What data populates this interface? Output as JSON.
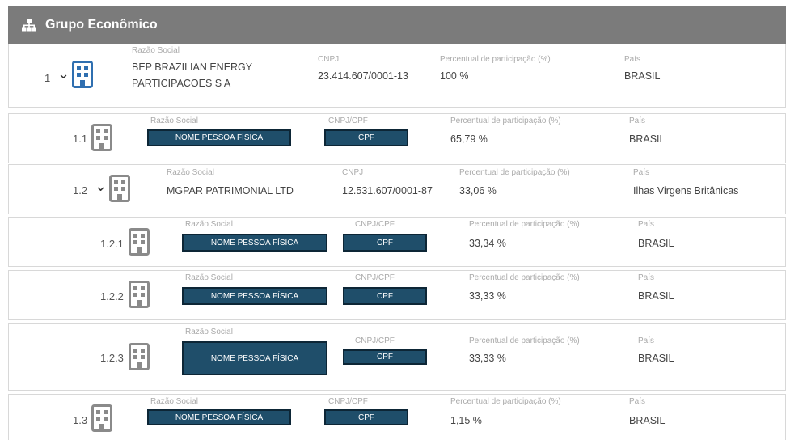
{
  "header": {
    "title": "Grupo Econômico",
    "icon": "org-chart-icon"
  },
  "labels": {
    "razao": "Razão Social",
    "cnpj": "CNPJ",
    "cnpjcpf": "CNPJ/CPF",
    "perc": "Percentual de participação (%)",
    "pais": "País"
  },
  "rows": [
    {
      "index": "1",
      "expandable": true,
      "name": "BEP BRAZILIAN ENERGY PARTICIPACOES S A",
      "doc": "23.414.607/0001-13",
      "percent": "100 %",
      "country": "BRASIL",
      "icon": "building-icon"
    },
    {
      "index": "1.1",
      "expandable": false,
      "name": "NOME PESSOA FÍSICA",
      "doc": "CPF",
      "percent": "65,79 %",
      "country": "BRASIL",
      "icon": "building-icon"
    },
    {
      "index": "1.2",
      "expandable": true,
      "name": "MGPAR PATRIMONIAL LTD",
      "doc": "12.531.607/0001-87",
      "percent": "33,06 %",
      "country": "Ilhas Virgens Britânicas",
      "icon": "building-icon"
    },
    {
      "index": "1.2.1",
      "expandable": false,
      "name": "NOME PESSOA FÍSICA",
      "doc": "CPF",
      "percent": "33,34 %",
      "country": "BRASIL",
      "icon": "building-icon"
    },
    {
      "index": "1.2.2",
      "expandable": false,
      "name": "NOME PESSOA FÍSICA",
      "doc": "CPF",
      "percent": "33,33 %",
      "country": "BRASIL",
      "icon": "building-icon"
    },
    {
      "index": "1.2.3",
      "expandable": false,
      "name": "NOME PESSOA FÍSICA",
      "doc": "CPF",
      "percent": "33,33 %",
      "country": "BRASIL",
      "icon": "building-icon"
    },
    {
      "index": "1.3",
      "expandable": false,
      "name": "NOME PESSOA FÍSICA",
      "doc": "CPF",
      "percent": "1,15 %",
      "country": "BRASIL",
      "icon": "building-icon"
    }
  ],
  "chevron": "⌄"
}
